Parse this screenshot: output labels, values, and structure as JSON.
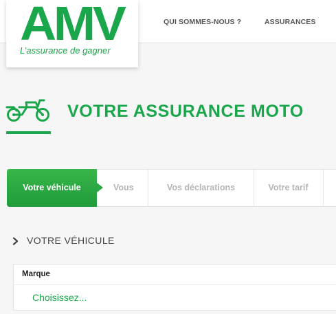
{
  "header": {
    "logo": {
      "mark": "AMV",
      "tagline": "L’assurance de gagner"
    },
    "nav": [
      "QUI SOMMES-NOUS ?",
      "ASSURANCES"
    ]
  },
  "page": {
    "title": "VOTRE ASSURANCE MOTO",
    "icon": "motorcycle-icon"
  },
  "steps": [
    {
      "label": "Votre véhicule",
      "active": true
    },
    {
      "label": "Vous",
      "active": false
    },
    {
      "label": "Vos déclarations",
      "active": false
    },
    {
      "label": "Votre tarif",
      "active": false
    },
    {
      "label": "",
      "active": false
    }
  ],
  "section": {
    "title": "VOTRE VÉHICULE",
    "icon": "chevron-right-icon"
  },
  "form": {
    "brand_label": "Marque",
    "brand_value": "Choisissez..."
  },
  "colors": {
    "brand_green": "#1aa64a",
    "step_active": "#2aa842",
    "text_muted": "#b5b5b5",
    "background": "#f6f6f6"
  }
}
